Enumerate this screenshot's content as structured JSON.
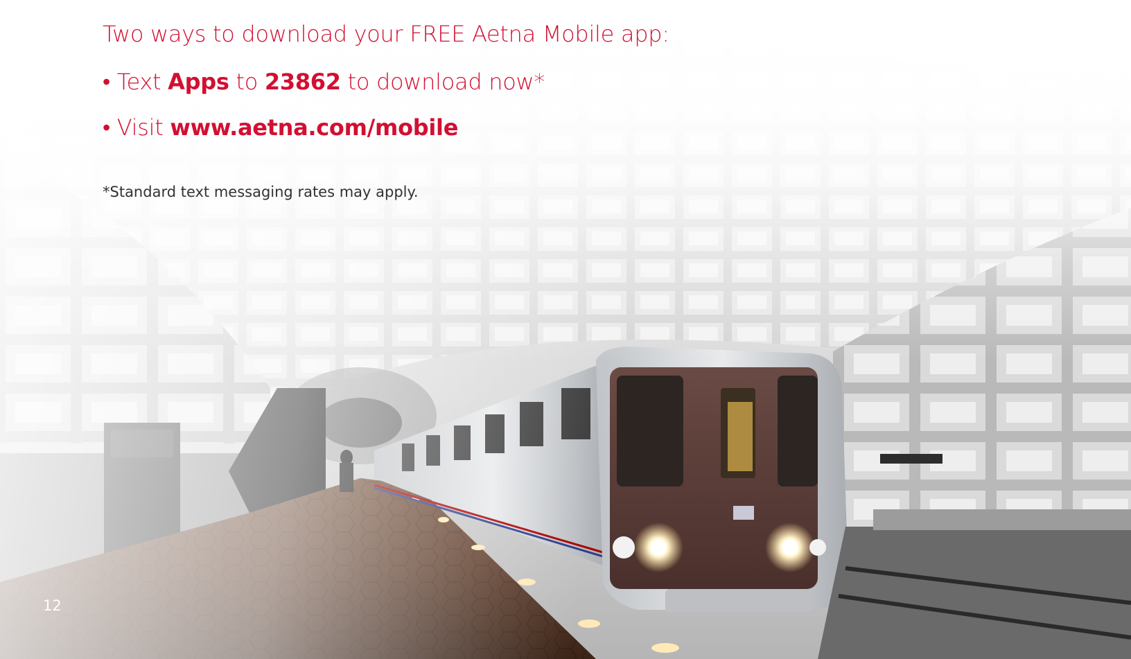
{
  "intro": "Two ways to download your FREE Aetna Mobile app:",
  "bullets": {
    "text_prefix": "• Text ",
    "text_keyword": "Apps",
    "text_to": " to ",
    "text_number": "23862",
    "text_suffix": " to download now*",
    "visit_prefix": "• Visit ",
    "visit_url": "www.aetna.com/mobile"
  },
  "footnote": "*Standard text messaging rates may apply.",
  "page_number": "12",
  "colors": {
    "accent": "#d20f32",
    "body_text": "#333333"
  }
}
